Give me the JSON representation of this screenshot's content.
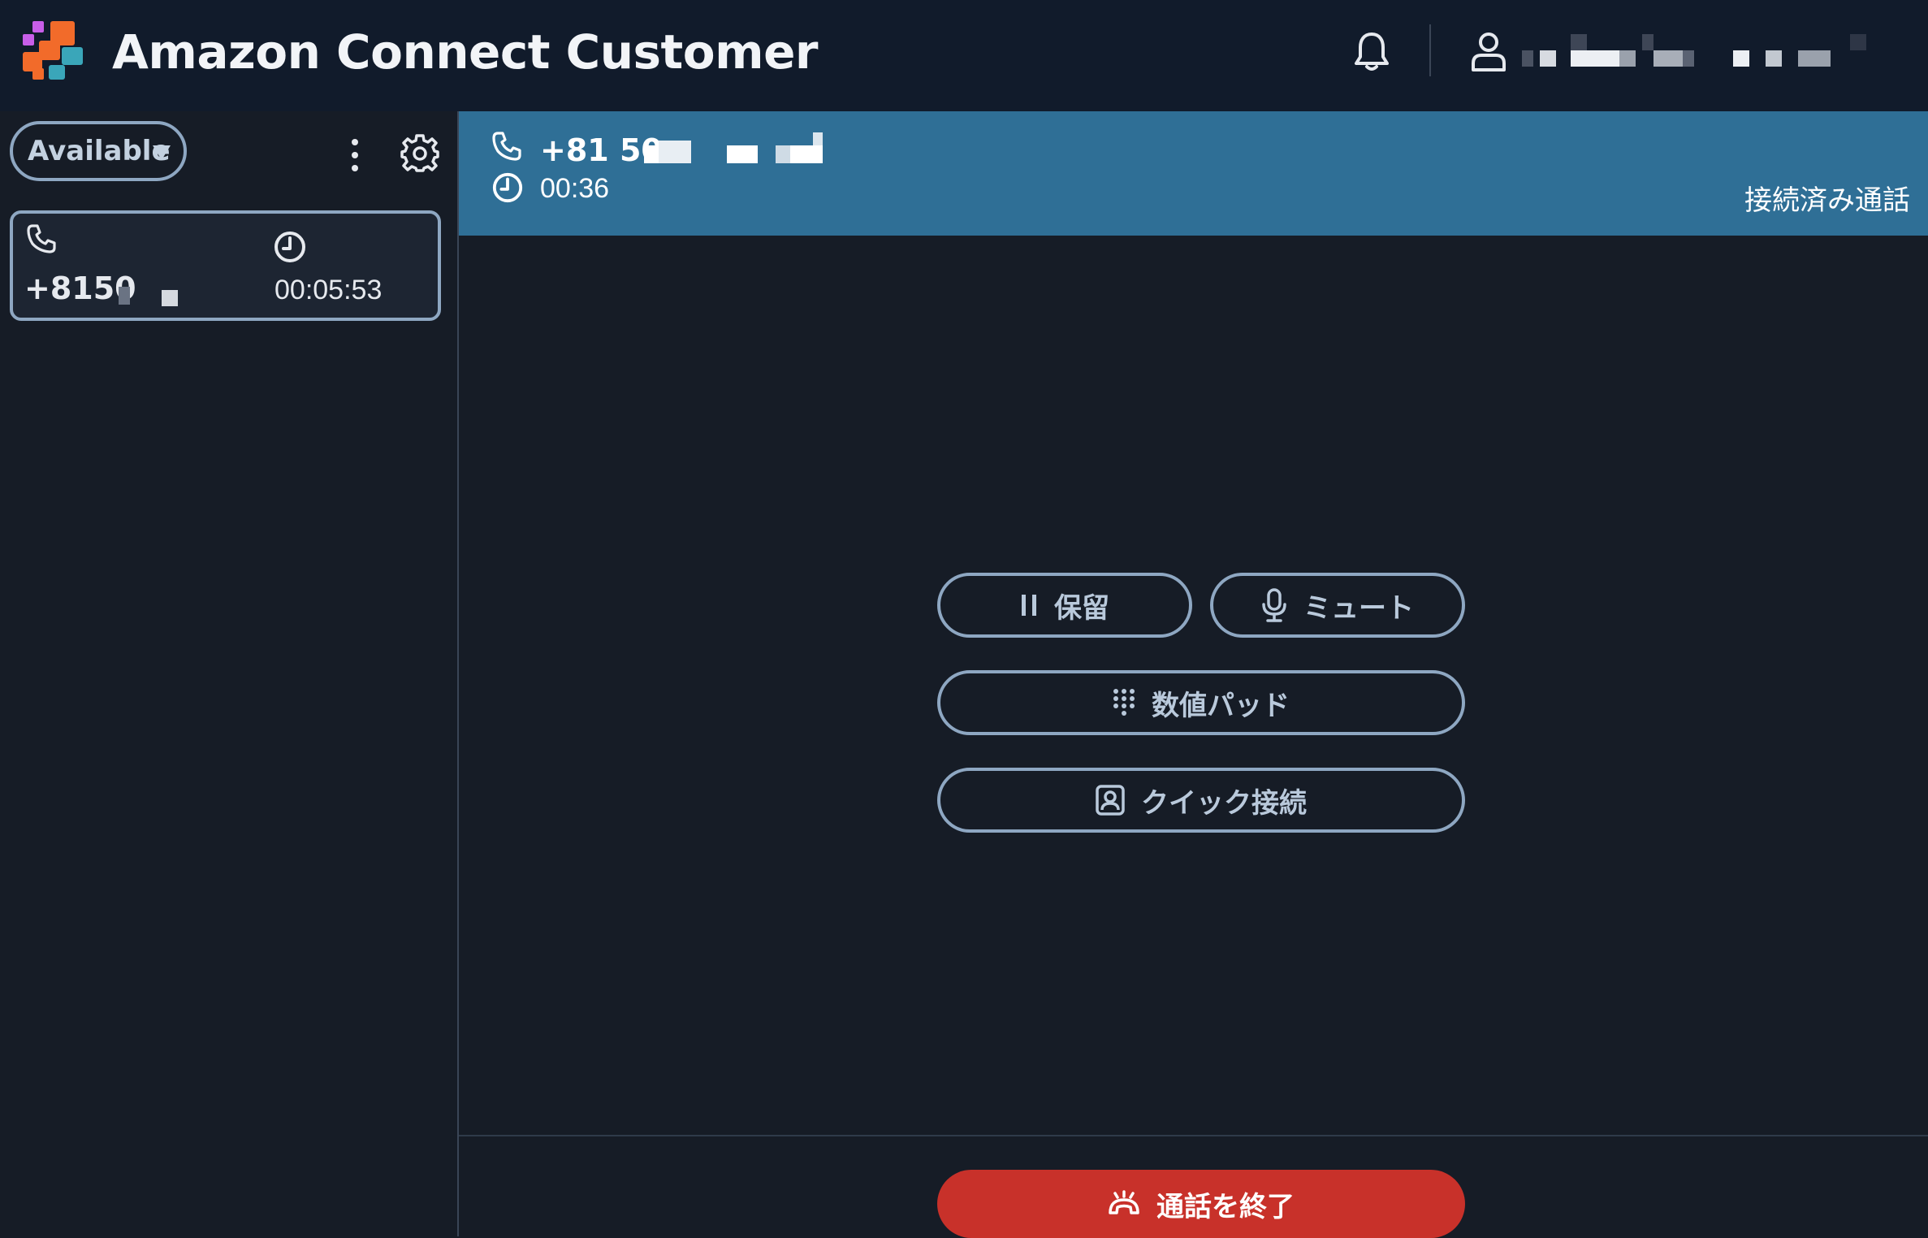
{
  "app": {
    "title": "Amazon Connect Customer"
  },
  "header": {
    "icons": [
      "bell-icon",
      "user-icon"
    ]
  },
  "sidebar": {
    "status_label": "Available",
    "contact": {
      "number": "+8150",
      "elapsed": "00:05:53"
    }
  },
  "call": {
    "number_prefix": "+81 50",
    "duration": "00:36",
    "state": "接続済み通話"
  },
  "actions": {
    "hold": "保留",
    "mute": "ミュート",
    "keypad": "数値パッド",
    "quick_connect": "クイック接続",
    "end_call": "通話を終了"
  },
  "colors": {
    "topbar": "#111b2b",
    "background": "#161c26",
    "call_header": "#2f6f96",
    "button_border": "#8ea7c2",
    "end_call": "#c8312a"
  }
}
